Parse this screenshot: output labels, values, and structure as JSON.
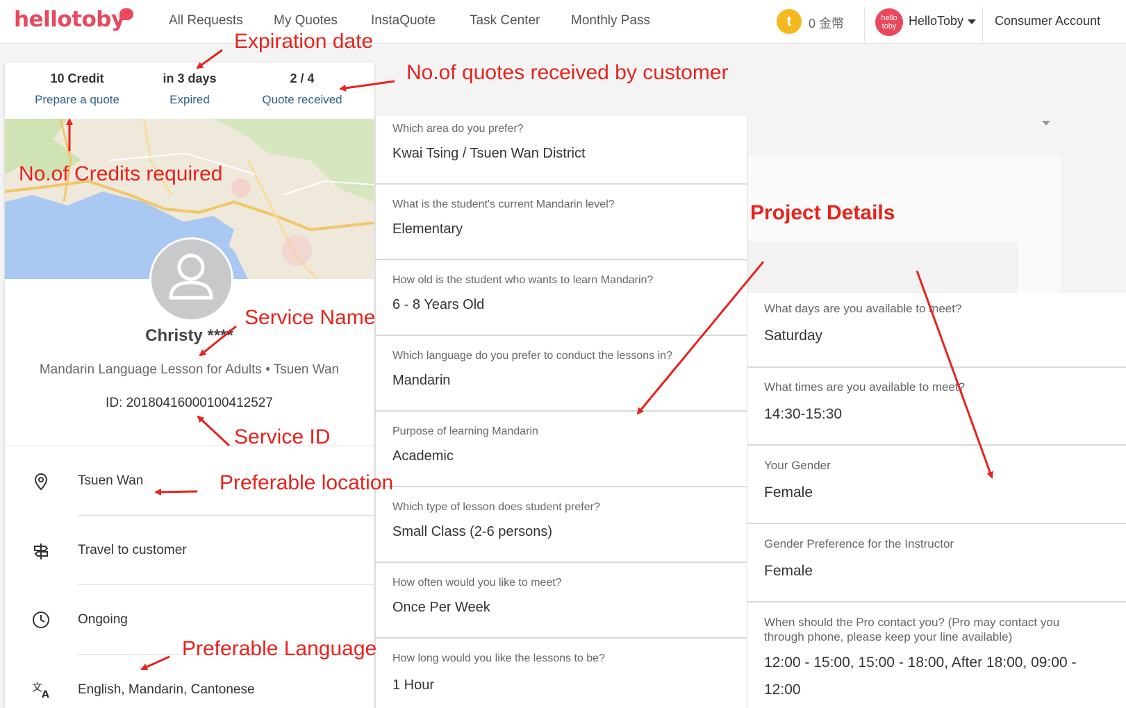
{
  "nav": {
    "logo": "hellotoby",
    "items": [
      "All Requests",
      "My Quotes",
      "InstaQuote",
      "Task Center",
      "Monthly Pass"
    ],
    "coin_icon": "t",
    "coin_text": "0 金幣",
    "avatar_text": "hello toby",
    "user_name": "HelloToby",
    "consumer_account": "Consumer Account"
  },
  "summary": {
    "credit": {
      "value": "10 Credit",
      "label": "Prepare a quote"
    },
    "expiry": {
      "value": "in 3 days",
      "label": "Expired"
    },
    "quotes": {
      "value": "2 / 4",
      "label": "Quote received"
    }
  },
  "client": {
    "name": "Christy ****",
    "service": "Mandarin Language Lesson for Adults • Tsuen Wan",
    "id": "ID: 20180416000100412527"
  },
  "info": {
    "location": "Tsuen Wan",
    "travel": "Travel to customer",
    "duration": "Ongoing",
    "languages": "English, Mandarin, Cantonese"
  },
  "questions": [
    {
      "q": "Which area do you prefer?",
      "a": "Kwai Tsing / Tsuen Wan District"
    },
    {
      "q": "What is the student's current Mandarin level?",
      "a": "Elementary"
    },
    {
      "q": "How old is the student who wants to learn Mandarin?",
      "a": "6 - 8 Years Old"
    },
    {
      "q": "Which language do you prefer to conduct the lessons in?",
      "a": "Mandarin"
    },
    {
      "q": "Purpose of learning Mandarin",
      "a": "Academic"
    },
    {
      "q": "Which type of lesson does student prefer?",
      "a": "Small Class (2-6 persons)"
    },
    {
      "q": "How often would you like to meet?",
      "a": "Once Per Week"
    },
    {
      "q": "How long would you like the lessons to be?",
      "a": "1 Hour"
    }
  ],
  "right_questions": [
    {
      "q": "What days are you available to meet?",
      "a": "Saturday"
    },
    {
      "q": "What times are you available to meet?",
      "a": "14:30-15:30"
    },
    {
      "q": "Your Gender",
      "a": "Female"
    },
    {
      "q": "Gender Preference for the Instructor",
      "a": "Female"
    },
    {
      "q": "When should the Pro contact you? (Pro may contact you through phone, please keep your line available)",
      "a": "12:00 - 15:00, 15:00 - 18:00, After 18:00, 09:00 - 12:00"
    }
  ],
  "annotations": {
    "expiration": "Expiration date",
    "quotes_received": "No.of quotes received by customer",
    "credits_required": "No.of Credits required",
    "project_details": "Project Details",
    "service_name": "Service Name",
    "service_id": "Service ID",
    "preferable_location": "Preferable location",
    "preferable_language": "Preferable Language"
  },
  "colors": {
    "brand": "#e9485e",
    "annotation": "#e8221c",
    "link": "#2f5f86"
  }
}
